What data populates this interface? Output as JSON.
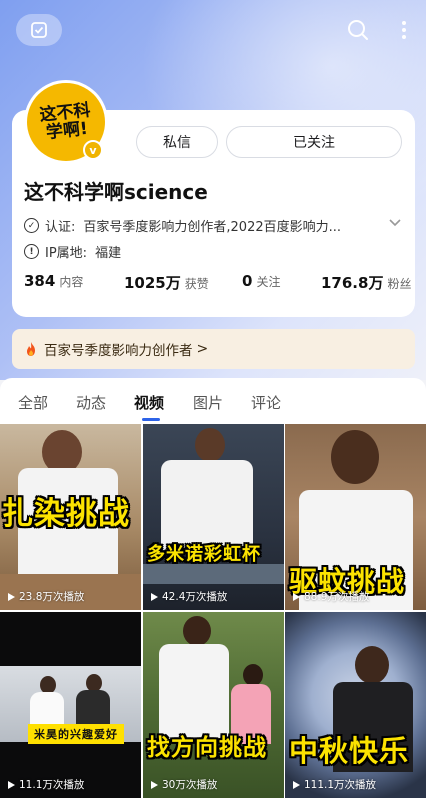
{
  "profile": {
    "avatar_text": "这不科学啊!",
    "verified_badge": "v",
    "message_button": "私信",
    "follow_button": "已关注",
    "name": "这不科学啊science",
    "cert_label": "认证:",
    "cert_value": "百家号季度影响力创作者,2022百度影响力...",
    "ip_label": "IP属地:",
    "ip_value": "福建",
    "stats": [
      {
        "num": "384",
        "unit": "内容"
      },
      {
        "num": "1025万",
        "unit": "获赞"
      },
      {
        "num": "0",
        "unit": "关注"
      },
      {
        "num": "176.8万",
        "unit": "粉丝"
      }
    ]
  },
  "banner": {
    "text": "百家号季度影响力创作者",
    "chevron": ">"
  },
  "tabs": [
    {
      "label": "全部",
      "active": false
    },
    {
      "label": "动态",
      "active": false
    },
    {
      "label": "视频",
      "active": true
    },
    {
      "label": "图片",
      "active": false
    },
    {
      "label": "评论",
      "active": false
    }
  ],
  "videos": [
    {
      "caption": "扎染挑战",
      "plays": "23.8万次播放"
    },
    {
      "caption": "多米诺彩虹杯",
      "plays": "42.4万次播放"
    },
    {
      "caption": "驱蚊挑战",
      "plays": "88.9万次播放"
    },
    {
      "caption": "米昊的兴趣爱好",
      "plays": "11.1万次播放"
    },
    {
      "caption": "找方向挑战",
      "plays": "30万次播放"
    },
    {
      "caption": "中秋快乐",
      "plays": "111.1万次播放"
    }
  ],
  "colors": {
    "accent": "#2d63e8",
    "caption_yellow": "#fce300",
    "banner_bg": "#f8efe2"
  },
  "icons": {
    "top_left": "checklist-icon",
    "search": "search-icon",
    "more": "more-vertical-icon",
    "cert": "check-circle-icon",
    "ip": "info-circle-icon",
    "banner": "fire-icon",
    "expand": "chevron-down-icon",
    "play": "play-icon"
  }
}
